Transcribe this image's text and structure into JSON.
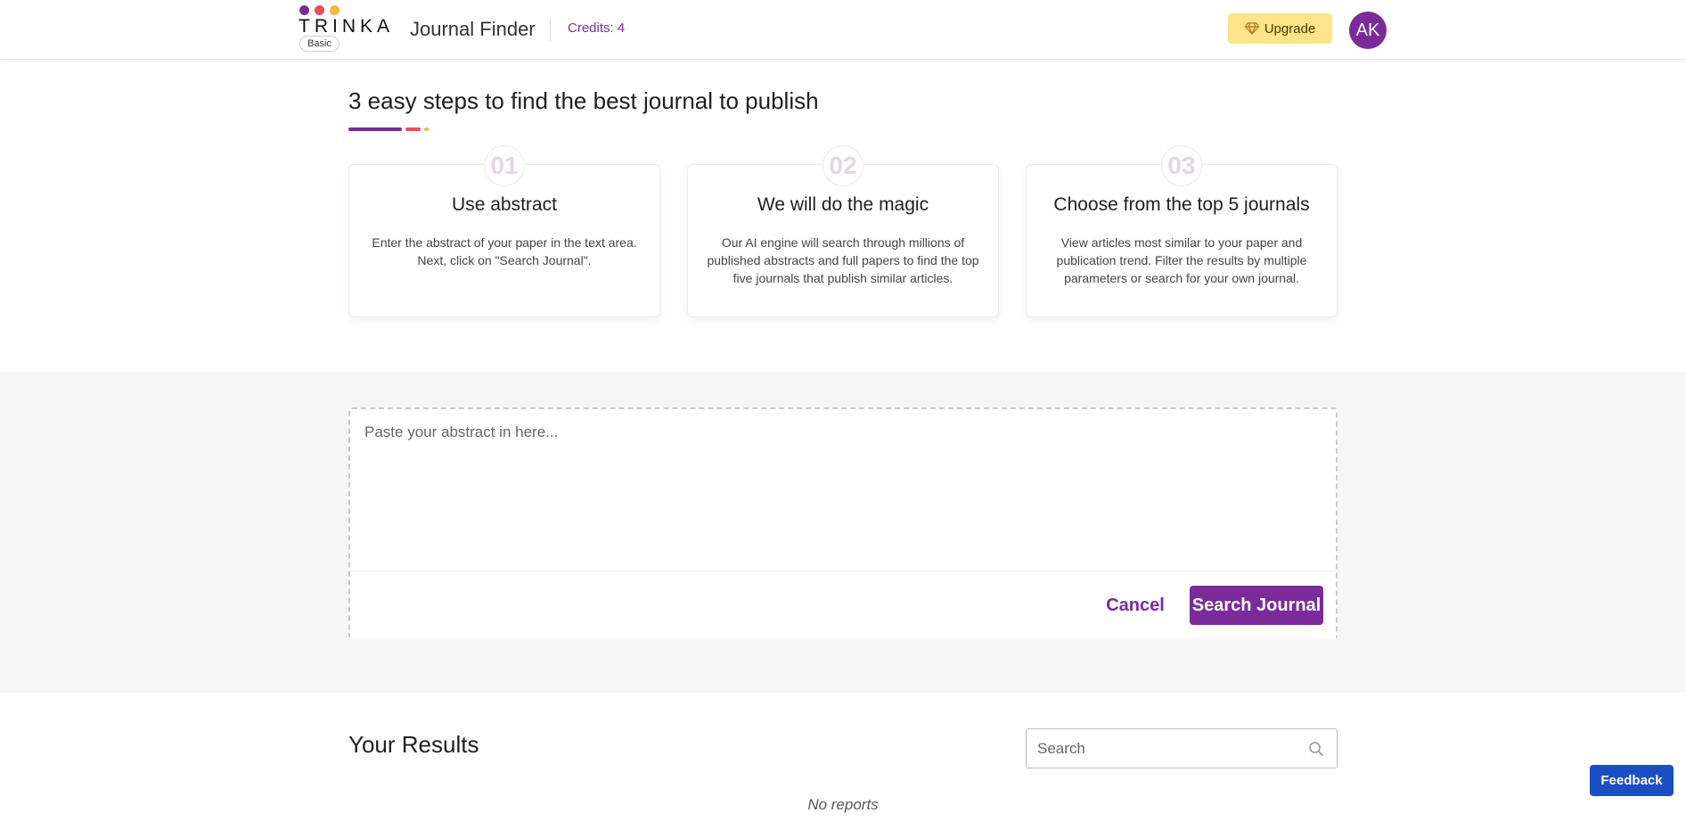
{
  "header": {
    "logo_text": "TRINKA",
    "plan_badge": "Basic",
    "app_title": "Journal Finder",
    "credits": "Credits: 4",
    "upgrade_label": "Upgrade",
    "avatar_initials": "AK",
    "logo_dot_colors": [
      "#7b2a99",
      "#ea4d5b",
      "#f6b93b"
    ]
  },
  "steps": {
    "title": "3 easy steps to find the best journal to publish",
    "underline_colors": [
      "#7b2a99",
      "#ea4d5b",
      "#f6b93b"
    ],
    "items": [
      {
        "number": "01",
        "title": "Use abstract",
        "description": "Enter the abstract of your paper in the text area. Next, click on \"Search Journal\"."
      },
      {
        "number": "02",
        "title": "We will do the magic",
        "description": "Our AI engine will search through millions of published abstracts and full papers to find the top five journals that publish similar articles."
      },
      {
        "number": "03",
        "title": "Choose from the top 5 journals",
        "description": "View articles most similar to your paper and publication trend. Filter the results by multiple parameters or search for your own journal."
      }
    ]
  },
  "abstract": {
    "placeholder": "Paste your abstract in here...",
    "value": "",
    "cancel_label": "Cancel",
    "search_label": "Search Journal"
  },
  "results": {
    "title": "Your Results",
    "search_placeholder": "Search",
    "empty_message": "No reports"
  },
  "feedback_label": "Feedback",
  "colors": {
    "brand_purple": "#7b2a99",
    "upgrade_yellow": "#fde48a",
    "feedback_blue": "#1a4fc4"
  }
}
